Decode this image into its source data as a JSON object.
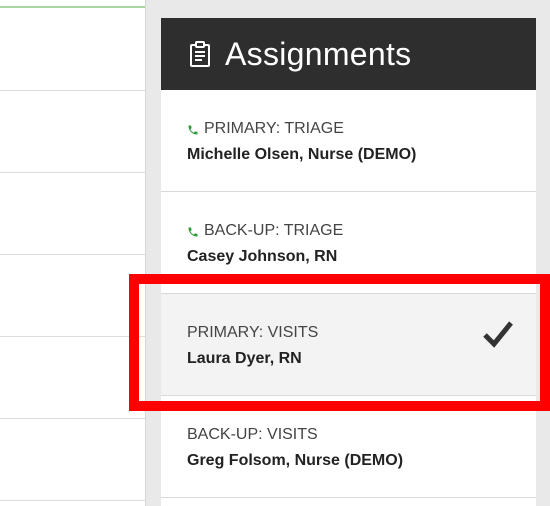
{
  "assignments": {
    "title": "Assignments",
    "items": [
      {
        "role": "PRIMARY: TRIAGE",
        "name": "Michelle Olsen, Nurse (DEMO)",
        "phone": true,
        "selected": false
      },
      {
        "role": "BACK-UP: TRIAGE",
        "name": "Casey Johnson, RN",
        "phone": true,
        "selected": false
      },
      {
        "role": "PRIMARY: VISITS",
        "name": "Laura Dyer, RN",
        "phone": false,
        "selected": true
      },
      {
        "role": "BACK-UP: VISITS",
        "name": "Greg Folsom, Nurse (DEMO)",
        "phone": false,
        "selected": false
      }
    ]
  },
  "colors": {
    "header_bg": "#2e2e2e",
    "phone_icon": "#2e9a3a",
    "highlight": "#ff0000",
    "selected_bg": "#f3f3f3"
  }
}
